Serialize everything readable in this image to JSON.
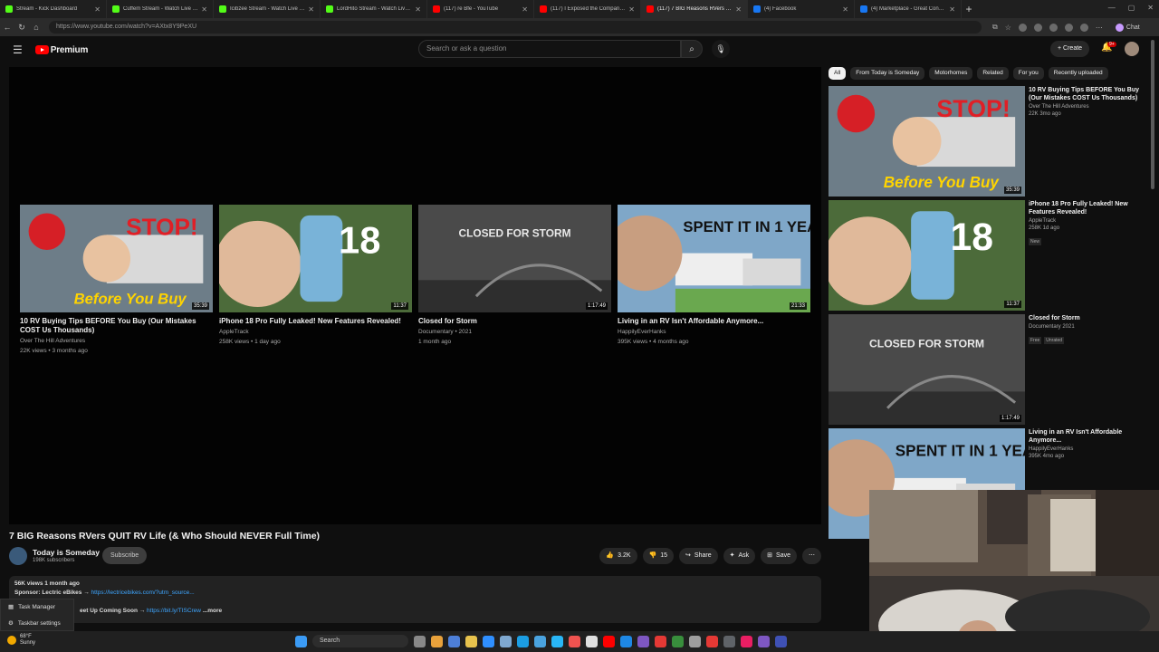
{
  "browser": {
    "tabs": [
      {
        "title": "Stream - Kick Dashboard",
        "color": "#53fc18",
        "active": false
      },
      {
        "title": "Cuffem Stream - Watch Live on Ki",
        "color": "#53fc18",
        "active": false
      },
      {
        "title": "Icibzee Stream - Watch Live on Ki",
        "color": "#53fc18",
        "active": false
      },
      {
        "title": "LordHito Stream - Watch Live on K",
        "color": "#53fc18",
        "active": false
      },
      {
        "title": "(117) re Bfe - YouTube",
        "color": "#ff0000",
        "active": false
      },
      {
        "title": "(117) I Exposed the Company Spy",
        "color": "#ff0000",
        "active": false
      },
      {
        "title": "(117) 7 BIG Reasons RVers QUIT R",
        "color": "#ff0000",
        "active": true
      },
      {
        "title": "(4) Facebook",
        "color": "#1877f2",
        "active": false
      },
      {
        "title": "(4) Marketplace - Great Condition",
        "color": "#1877f2",
        "active": false
      }
    ],
    "url": "https://www.youtube.com/watch?v=AXtx8Y9PeXU",
    "chat_label": "Chat"
  },
  "header": {
    "logo_text": "Premium",
    "search_placeholder": "Search or ask a question",
    "create_label": "Create",
    "notif_count": "9+"
  },
  "endcards": [
    {
      "title": "10 RV Buying Tips BEFORE You Buy (Our Mistakes COST Us Thousands)",
      "channel": "Over The Hill Adventures",
      "meta": "22K views • 3 months ago",
      "duration": "35:39",
      "thumb_text": "Before You Buy"
    },
    {
      "title": "iPhone 18 Pro Fully Leaked! New Features Revealed!",
      "channel": "AppleTrack",
      "meta": "258K views • 1 day ago",
      "duration": "11:37",
      "thumb_text": "18"
    },
    {
      "title": "Closed for Storm",
      "channel": "Documentary • 2021",
      "meta": "1 month ago",
      "duration": "1:17:49",
      "thumb_text": "CLOSED FOR STORM"
    },
    {
      "title": "Living in an RV Isn't Affordable Anymore...",
      "channel": "HappilyEverHanks",
      "meta": "395K views • 4 months ago",
      "duration": "21:33",
      "thumb_text": "SPENT IT IN 1 YEAR!"
    }
  ],
  "video": {
    "title": "7 BIG Reasons RVers QUIT RV Life (& Who Should NEVER Full Time)",
    "channel": "Today is Someday",
    "subscribers": "198K subscribers",
    "subscribe_label": "Subscribe",
    "likes": "3.2K",
    "dislikes": "15",
    "share_label": "Share",
    "ask_label": "Ask",
    "save_label": "Save"
  },
  "description": {
    "stats": "56K views  1 month ago",
    "sponsor_prefix": "Sponsor: Lectric eBikes → ",
    "sponsor_link": "https://lectricebikes.com/?utm_source...",
    "line2_prefix": "eet Up Coming Soon → ",
    "line2_link": "https://bit.ly/TISCrew",
    "more_label": "...more"
  },
  "chips": [
    "All",
    "From Today is Someday",
    "Motorhomes",
    "Related",
    "For you",
    "Recently uploaded"
  ],
  "recommendations": [
    {
      "title": "10 RV Buying Tips BEFORE You Buy (Our Mistakes COST Us Thousands)",
      "channel": "Over The Hill Adventures",
      "meta": "22K  3mo ago",
      "duration": "35:39",
      "badges": []
    },
    {
      "title": "iPhone 18 Pro Fully Leaked! New Features Revealed!",
      "channel": "AppleTrack",
      "meta": "258K  1d ago",
      "duration": "11:37",
      "badges": [
        "New"
      ]
    },
    {
      "title": "Closed for Storm",
      "channel": "Documentary 2021",
      "meta": "",
      "duration": "1:17:49",
      "badges": [
        "Free",
        "Unrated"
      ]
    },
    {
      "title": "Living in an RV Isn't Affordable Anymore...",
      "channel": "HappilyEverHanks",
      "meta": "395K  4mo ago",
      "duration": "",
      "badges": []
    }
  ],
  "popup": {
    "item1": "Task Manager",
    "item2": "Taskbar settings"
  },
  "taskbar": {
    "temp": "68°F",
    "condition": "Sunny",
    "search_label": "Search"
  }
}
